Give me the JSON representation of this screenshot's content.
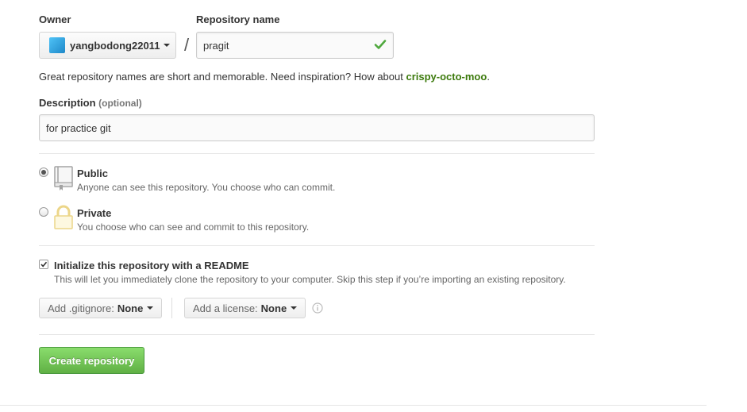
{
  "owner": {
    "label": "Owner",
    "name": "yangbodong22011"
  },
  "repo": {
    "label": "Repository name",
    "value": "pragit",
    "separator": "/"
  },
  "hint": {
    "text": "Great repository names are short and memorable. Need inspiration? How about ",
    "suggestion": "crispy-octo-moo",
    "suffix": "."
  },
  "description": {
    "label": "Description",
    "optional": "(optional)",
    "value": "for practice git"
  },
  "visibility": {
    "public": {
      "title": "Public",
      "note": "Anyone can see this repository. You choose who can commit.",
      "selected": true
    },
    "private": {
      "title": "Private",
      "note": "You choose who can see and commit to this repository.",
      "selected": false
    }
  },
  "readme": {
    "checked": true,
    "title": "Initialize this repository with a README",
    "note": "This will let you immediately clone the repository to your computer. Skip this step if you’re importing an existing repository."
  },
  "gitignore": {
    "label": "Add .gitignore:",
    "value": "None"
  },
  "license": {
    "label": "Add a license:",
    "value": "None"
  },
  "create_button": "Create repository",
  "colors": {
    "accent_green": "#6cc644",
    "suggestion_green": "#3c7a0c",
    "check_green": "#4fa83d"
  }
}
